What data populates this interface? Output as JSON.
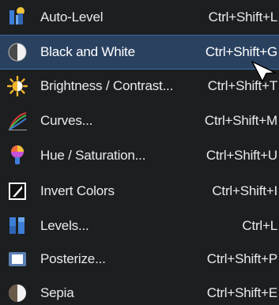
{
  "menu": {
    "items": [
      {
        "label": "Auto-Level",
        "shortcut": "Ctrl+Shift+L",
        "icon": "auto-level-icon"
      },
      {
        "label": "Black and White",
        "shortcut": "Ctrl+Shift+G",
        "icon": "black-and-white-icon",
        "selected": true
      },
      {
        "label": "Brightness / Contrast...",
        "shortcut": "Ctrl+Shift+T",
        "icon": "brightness-icon"
      },
      {
        "label": "Curves...",
        "shortcut": "Ctrl+Shift+M",
        "icon": "curves-icon"
      },
      {
        "label": "Hue / Saturation...",
        "shortcut": "Ctrl+Shift+U",
        "icon": "hue-saturation-icon"
      },
      {
        "label": "Invert Colors",
        "shortcut": "Ctrl+Shift+I",
        "icon": "invert-colors-icon"
      },
      {
        "label": "Levels...",
        "shortcut": "Ctrl+L",
        "icon": "levels-icon"
      },
      {
        "label": "Posterize...",
        "shortcut": "Ctrl+Shift+P",
        "icon": "posterize-icon"
      },
      {
        "label": "Sepia",
        "shortcut": "Ctrl+Shift+E",
        "icon": "sepia-icon"
      }
    ]
  },
  "colors": {
    "background": "#1d1e20",
    "selection": "#2a4160",
    "selection_border": "#3c6fa8",
    "text": "#e9eaec"
  }
}
